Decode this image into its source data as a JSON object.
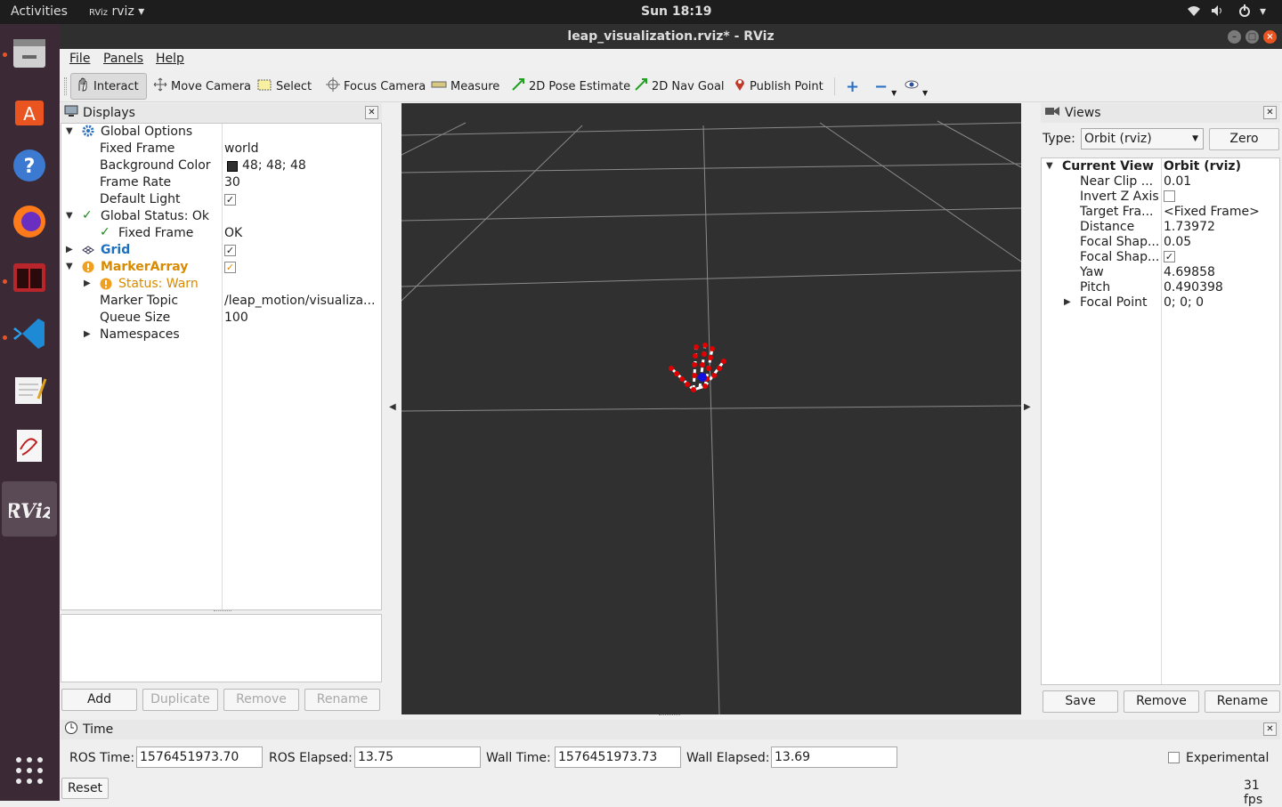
{
  "topbar": {
    "activities": "Activities",
    "app": "rviz",
    "clock": "Sun 18:19"
  },
  "window": {
    "title": "leap_visualization.rviz* - RViz"
  },
  "menu": {
    "file": "File",
    "panels": "Panels",
    "help": "Help"
  },
  "toolbar": {
    "interact": "Interact",
    "move_camera": "Move Camera",
    "select": "Select",
    "focus_camera": "Focus Camera",
    "measure": "Measure",
    "pose_estimate": "2D Pose Estimate",
    "nav_goal": "2D Nav Goal",
    "publish_point": "Publish Point"
  },
  "displays": {
    "title": "Displays",
    "global_options": "Global Options",
    "fixed_frame_label": "Fixed Frame",
    "fixed_frame_value": "world",
    "bg_color_label": "Background Color",
    "bg_color_value": "48; 48; 48",
    "bg_color_swatch": "#303030",
    "frame_rate_label": "Frame Rate",
    "frame_rate_value": "30",
    "default_light_label": "Default Light",
    "global_status": "Global Status: Ok",
    "fixed_frame_status_label": "Fixed Frame",
    "fixed_frame_status_value": "OK",
    "grid": "Grid",
    "marker_array": "MarkerArray",
    "status_warn": "Status: Warn",
    "marker_topic_label": "Marker Topic",
    "marker_topic_value": "/leap_motion/visualiza...",
    "queue_size_label": "Queue Size",
    "queue_size_value": "100",
    "namespaces": "Namespaces",
    "buttons": {
      "add": "Add",
      "duplicate": "Duplicate",
      "remove": "Remove",
      "rename": "Rename"
    }
  },
  "views": {
    "title": "Views",
    "type_label": "Type:",
    "type_value": "Orbit (rviz)",
    "zero": "Zero",
    "current_view_label": "Current View",
    "current_view_value": "Orbit (rviz)",
    "props": [
      {
        "label": "Near Clip ...",
        "value": "0.01"
      },
      {
        "label": "Invert Z Axis",
        "value": ""
      },
      {
        "label": "Target Fra...",
        "value": "<Fixed Frame>"
      },
      {
        "label": "Distance",
        "value": "1.73972"
      },
      {
        "label": "Focal Shap...",
        "value": "0.05"
      },
      {
        "label": "Focal Shap...",
        "value": ""
      },
      {
        "label": "Yaw",
        "value": "4.69858"
      },
      {
        "label": "Pitch",
        "value": "0.490398"
      },
      {
        "label": "Focal Point",
        "value": "0; 0; 0"
      }
    ],
    "buttons": {
      "save": "Save",
      "remove": "Remove",
      "rename": "Rename"
    }
  },
  "time": {
    "title": "Time",
    "ros_time_label": "ROS Time:",
    "ros_time": "1576451973.70",
    "ros_elapsed_label": "ROS Elapsed:",
    "ros_elapsed": "13.75",
    "wall_time_label": "Wall Time:",
    "wall_time": "1576451973.73",
    "wall_elapsed_label": "Wall Elapsed:",
    "wall_elapsed": "13.69",
    "experimental": "Experimental",
    "reset": "Reset",
    "fps": "31 fps"
  },
  "colors": {
    "accent": "#e95420",
    "grid_blue": "#1f6fbf",
    "warn": "#d88a00",
    "ok_green": "#1a8a1a"
  }
}
